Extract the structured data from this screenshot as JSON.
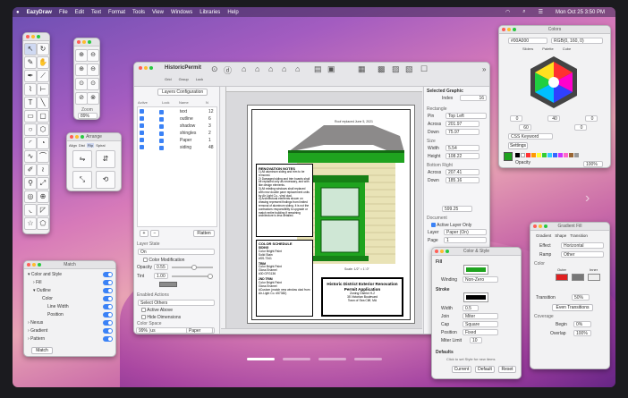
{
  "menubar": {
    "app": "EazyDraw",
    "items": [
      "File",
      "Edit",
      "Text",
      "Format",
      "Tools",
      "View",
      "Windows",
      "Libraries",
      "Help"
    ],
    "datetime": "Mon Oct 25  3:50 PM"
  },
  "zoom_panel": {
    "title": "Zoom",
    "value": "89%"
  },
  "arrange_panel": {
    "title": "Arrange",
    "tabs": [
      "Align",
      "Dist",
      "Flip",
      "Spiral"
    ]
  },
  "main_window": {
    "title": "HistoricPermit",
    "toolbar_labels": [
      "Grid",
      "Group",
      "Lock"
    ]
  },
  "layers": {
    "title": "Layers Configuration",
    "headers": [
      "Active",
      "Lock",
      "Name",
      "N"
    ],
    "rows": [
      {
        "name": "text",
        "n": "12"
      },
      {
        "name": "outline",
        "n": "6"
      },
      {
        "name": "shadow",
        "n": "3"
      },
      {
        "name": "shingles",
        "n": "2"
      },
      {
        "name": "Paper",
        "n": "1"
      },
      {
        "name": "siding",
        "n": "48"
      }
    ],
    "flatten": "Flatten",
    "state_label": "Layer State",
    "state_value": "On",
    "color_mod": "Color Modification",
    "opacity_label": "Opacity",
    "opacity_value": "0.55",
    "tint_label": "Tint",
    "tint_value": "1.00",
    "enabled_label": "Enabled Actions",
    "enabled_value": "Select Others",
    "active_above": "Active Above",
    "hide_dims": "Hide Dimensions",
    "color_space_label": "Color Space",
    "color_space_value": "Various",
    "zoom_value": "99%",
    "paper": "Paper"
  },
  "drawing": {
    "roof_caption": "Roof replaced June 5, 2021",
    "notes_title": "RENOVATION NOTES",
    "notes_body": [
      "1) All aluminum siding and trim to be removed.",
      "2) Damaged siding and trim boards shall be replaced only as necessary, and with like design elements.",
      "3) All existing windows shall replaced with new double pane replacement units by Air Light Co.- vinyl clad.",
      "4) Architectural elements shown on drawing represent findings from limited removal of aluminum siding. It is not the contractors responsibility to upgrade or match entire building if remaining architecture is less detailed."
    ],
    "schedule_title": "COLOR SCHEDULE",
    "schedule_body": [
      "SIDING",
      "Color Bright Paint",
      "Solid Stain",
      "#SS-T341",
      "",
      "TRIM",
      "Color Bright Paint",
      "Gloss Enamel",
      "#30 GFG136",
      "",
      "2ND TRIM",
      "Color Bright Paint",
      "Gloss Enamel",
      "#Custom (match new window clad from Air-Light Co. #57382)"
    ],
    "scale": "Scale: 1/2\" = 1'-0\"",
    "title_block": "Historic District Exterior Renovation Permit Application",
    "zone": "Zoning District H-2",
    "address": "35 Victorian Boulevard",
    "town": "Town of Sea Cliff, MA"
  },
  "selected": {
    "title": "Selected Graphic",
    "index_label": "Index",
    "index_value": "16",
    "rect_label": "Rectangle",
    "pin_label": "Pin",
    "pin_value": "Top Left",
    "across_label": "Across",
    "across_value": "201.97",
    "down_label": "Down",
    "down_value": "75.97",
    "size_label": "Size",
    "width_label": "Width",
    "width_value": "5.54",
    "height_label": "Height",
    "height_value": "108.22",
    "br_label": "Bottom Right",
    "br_across": "207.41",
    "br_down": "185.16",
    "area_value": "599.25",
    "doc_label": "Document",
    "active_layer": "Active Layer Only",
    "layer_label": "Layer",
    "layer_value": "Paper (On)",
    "page_label": "Page",
    "page_value": "1"
  },
  "colors_panel": {
    "title": "Colors",
    "hex": "#00A000",
    "rgb": "RGB(0, 160, 0)",
    "tabs": [
      "Sliders",
      "Palette",
      "Cube"
    ],
    "v1": "0",
    "v2": "40",
    "v3": "0",
    "v4": "60",
    "v5": "0",
    "kw": "CSS Keyword",
    "settings": "Settings",
    "opacity_label": "Opacity",
    "opacity_value": "100%"
  },
  "match_panel": {
    "title": "Match",
    "items": [
      "Color and Style",
      "Fill",
      "Outline",
      "Color",
      "Line Width",
      "Position",
      "Nexus",
      "Gradient",
      "Pattern"
    ],
    "button": "Match"
  },
  "color_style": {
    "title": "Color & Style",
    "fill_label": "Fill",
    "winding_label": "Winding",
    "winding_value": "Non-Zero",
    "stroke_label": "Stroke",
    "width_label": "Width",
    "width_value": "0.5",
    "join_label": "Join",
    "join_value": "Miter",
    "cap_label": "Cap",
    "cap_value": "Square",
    "position_label": "Position",
    "position_value": "Fixed",
    "miter_label": "Miter Limit",
    "miter_value": "10",
    "defaults_label": "Defaults",
    "hint": "Click to set Style for new items",
    "current": "Current",
    "default": "Default",
    "reset": "Reset"
  },
  "gradient": {
    "title": "Gradient Fill",
    "tabs": [
      "Gradient",
      "Shape",
      "Transition"
    ],
    "effect_label": "Effect",
    "effect_value": "Horizontal",
    "ramp_label": "Ramp",
    "ramp_value": "Other",
    "color_label": "Color",
    "outer_label": "Outer",
    "inner_label": "Inner",
    "transition_label": "Transition",
    "transition_value": "50%",
    "even": "Even Transitions",
    "coverage_label": "Coverage",
    "begin_label": "Begin",
    "begin_value": "0%",
    "overlap_label": "Overlap",
    "overlap_value": "100%"
  },
  "colors": {
    "green": "#1fa31f",
    "wall": "#e9e3b6",
    "shingle": "#8c8a8a"
  }
}
